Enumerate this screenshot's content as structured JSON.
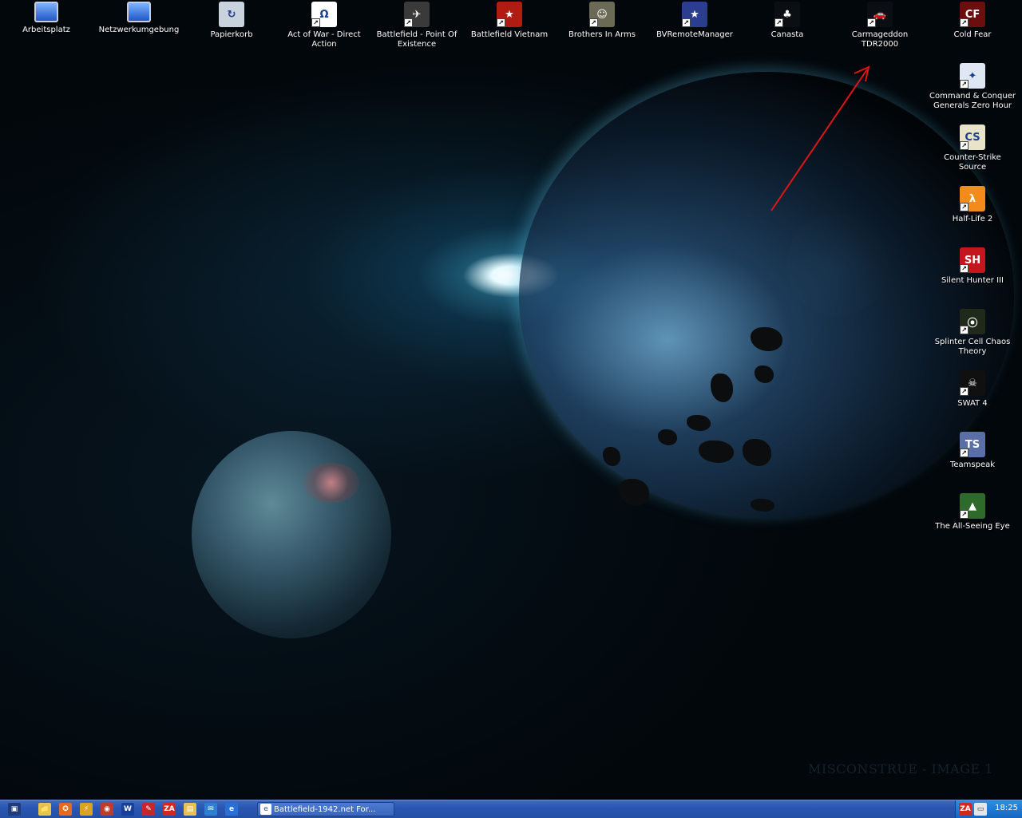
{
  "desktop": {
    "wallpaper_caption": "MISCONSTRUE - IMAGE 1",
    "icons": [
      {
        "label": "Arbeitsplatz",
        "icon": "my-computer-icon",
        "color": "#2a64c8",
        "glyph": ""
      },
      {
        "label": "Netzwerkumgebung",
        "icon": "network-icon",
        "color": "#2a64c8",
        "glyph": ""
      },
      {
        "label": "Papierkorb",
        "icon": "recycle-bin-icon",
        "color": "#c9d3de",
        "glyph": "↻"
      },
      {
        "label": "Act of War - Direct\nAction",
        "icon": "act-of-war-icon",
        "color": "#ffffff",
        "glyph": "Ω"
      },
      {
        "label": "Battlefield - Point Of\nExistence",
        "icon": "battlefield-poe-icon",
        "color": "#3a3a3a",
        "glyph": "✈"
      },
      {
        "label": "Battlefield Vietnam",
        "icon": "battlefield-vietnam-icon",
        "color": "#b01b12",
        "glyph": "★"
      },
      {
        "label": "Brothers In Arms",
        "icon": "brothers-in-arms-icon",
        "color": "#6b6a55",
        "glyph": "☺"
      },
      {
        "label": "BVRemoteManager",
        "icon": "bvremotemanager-icon",
        "color": "#2b3d8f",
        "glyph": "★"
      },
      {
        "label": "Canasta",
        "icon": "canasta-icon",
        "color": "#0b0f14",
        "glyph": "♣"
      },
      {
        "label": "Carmageddon\nTDR2000",
        "icon": "carmageddon-icon",
        "color": "#0b0f14",
        "glyph": "🚗"
      },
      {
        "label": "Cold Fear",
        "icon": "cold-fear-icon",
        "color": "#6b0e0e",
        "glyph": "CF"
      },
      {
        "label": "Command & Conquer\nGenerals Zero Hour",
        "icon": "command-conquer-icon",
        "color": "#dfe7f2",
        "glyph": "✦"
      },
      {
        "label": "Counter-Strike\nSource",
        "icon": "counter-strike-icon",
        "color": "#e9e4c9",
        "glyph": "CS"
      },
      {
        "label": "Half-Life 2",
        "icon": "half-life-2-icon",
        "color": "#f28b1a",
        "glyph": "λ"
      },
      {
        "label": "Silent Hunter III",
        "icon": "silent-hunter-icon",
        "color": "#c4161c",
        "glyph": "SH"
      },
      {
        "label": "Splinter Cell Chaos\nTheory",
        "icon": "splinter-cell-icon",
        "color": "#1f2a1a",
        "glyph": "⦿"
      },
      {
        "label": "SWAT 4",
        "icon": "swat4-icon",
        "color": "#101010",
        "glyph": "☠"
      },
      {
        "label": "Teamspeak",
        "icon": "teamspeak-icon",
        "color": "#5a6fa8",
        "glyph": "TS"
      },
      {
        "label": "The All-Seeing Eye",
        "icon": "all-seeing-eye-icon",
        "color": "#2e6b2a",
        "glyph": "▲"
      }
    ]
  },
  "taskbar": {
    "quicklaunch": [
      {
        "icon": "show-desktop-icon",
        "glyph": "▣",
        "color": "#1e3d7a"
      },
      {
        "icon": "explorer-folder-icon",
        "glyph": "📁",
        "color": "#e9c44a"
      },
      {
        "icon": "firefox-icon",
        "glyph": "✪",
        "color": "#e36b1d"
      },
      {
        "icon": "winamp-icon",
        "glyph": "⚡",
        "color": "#d8a421"
      },
      {
        "icon": "chrome-like-icon",
        "glyph": "◉",
        "color": "#c23a2a"
      },
      {
        "icon": "word-icon",
        "glyph": "W",
        "color": "#1a3f9b"
      },
      {
        "icon": "paint-icon",
        "glyph": "✎",
        "color": "#c8262c"
      },
      {
        "icon": "zonealarm-icon",
        "glyph": "ZA",
        "color": "#d3271f"
      },
      {
        "icon": "notepad-icon",
        "glyph": "▤",
        "color": "#e7c251"
      },
      {
        "icon": "outlook-icon",
        "glyph": "✉",
        "color": "#2f7fd0"
      },
      {
        "icon": "internet-explorer-icon",
        "glyph": "e",
        "color": "#2a6fd6"
      }
    ],
    "task": {
      "label": "Battlefield-1942.net For...",
      "icon": "ie-page-icon"
    },
    "tray": {
      "icon": "zonealarm-tray-icon",
      "glyph": "ZA",
      "extra_icon": "network-tray-icon",
      "clock": "18:25"
    }
  }
}
